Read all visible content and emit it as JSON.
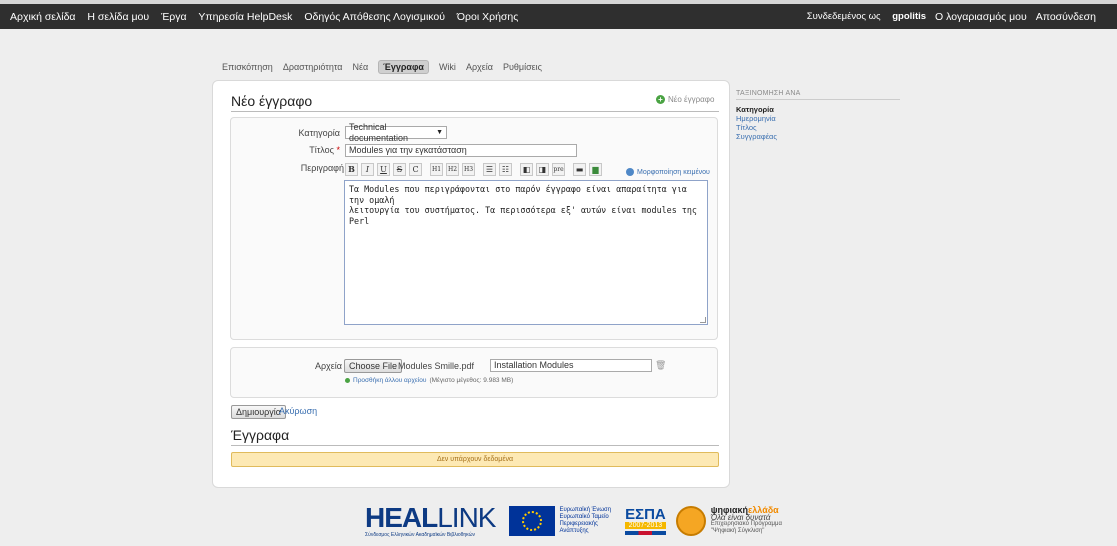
{
  "topnav": {
    "items": [
      "Αρχική σελίδα",
      "Η σελίδα μου",
      "Έργα",
      "Υπηρεσία HelpDesk",
      "Οδηγός Απόθεσης Λογισμικού",
      "Όροι Χρήσης"
    ],
    "logged_in_prefix": "Συνδεδεμένος ως",
    "username": "gpolitis",
    "my_account": "Ο λογαριασμός μου",
    "logout": "Αποσύνδεση"
  },
  "project_tabs": {
    "items": [
      "Επισκόπηση",
      "Δραστηριότητα",
      "Νέα",
      "Έγγραφα",
      "Wiki",
      "Αρχεία",
      "Ρυθμίσεις"
    ],
    "selected": "Έγγραφα"
  },
  "page": {
    "title": "Νέο έγγραφο",
    "new_doc_link": "Νέο έγγραφο"
  },
  "form": {
    "category_label": "Κατηγορία",
    "category_value": "Technical documentation",
    "title_label": "Τίτλος",
    "title_required": "*",
    "title_value": "Modules για την εγκατάσταση",
    "description_label": "Περιγραφή",
    "toolbar": [
      "B",
      "I",
      "U",
      "S",
      "C",
      "H1",
      "H2",
      "H3",
      "ul",
      "ol",
      "◧",
      "◨",
      "pre",
      "img-link",
      "img"
    ],
    "formatting_help": "Μορφοποίηση κειμένου",
    "description_value": "Τα Modules που περιγράφονται στο παρόν έγγραφο είναι απαραίτητα για την ομαλή\nλειτουργία του συστήματος. Τα περισσότερα εξ' αυτών είναι modules της Perl"
  },
  "files": {
    "label": "Αρχεία",
    "choose_file": "Choose File",
    "file_name": "Modules Smille.pdf",
    "description_value": "Installation Modules",
    "add_another": "Προσθήκη άλλου αρχείου",
    "max_size": "(Μέγιστο μέγεθος: 9.983 MB)"
  },
  "actions": {
    "create": "Δημιουργία",
    "cancel": "Ακύρωση"
  },
  "documents": {
    "heading": "Έγγραφα",
    "no_data": "Δεν υπάρχουν δεδομένα"
  },
  "sidebar": {
    "title": "ΤΑΞΙΝΟΜΗΣΗ ΑΝΑ",
    "items": [
      {
        "label": "Κατηγορία",
        "active": true
      },
      {
        "label": "Ημερομηνία",
        "active": false
      },
      {
        "label": "Τίτλος",
        "active": false
      },
      {
        "label": "Συγγραφέας",
        "active": false
      }
    ]
  },
  "footer": {
    "heal_bold": "HEAL",
    "heal_thin": "LINK",
    "heal_sub": "Σύνδεσμος Ελληνικών Ακαδημαϊκών Βιβλιοθηκών",
    "eu_lines": [
      "Ευρωπαϊκή Ένωση",
      "Ευρωπαϊκό Ταμείο",
      "Περιφερειακής",
      "Ανάπτυξης"
    ],
    "espa_name": "ΕΣΠΑ",
    "espa_years": "2007-2013",
    "digital_a": "ψηφιακή",
    "digital_b": "ελλάδα",
    "digital_slogan": "Όλα είναι δυνατά",
    "digital_lines": [
      "Επιχειρησιακό Πρόγραμμα",
      "\"Ψηφιακή Σύγκλιση\""
    ]
  },
  "colors": {
    "topbar": "#2f2f2f",
    "link": "#3a6fb0",
    "nodata_bg": "#fde9b4"
  }
}
